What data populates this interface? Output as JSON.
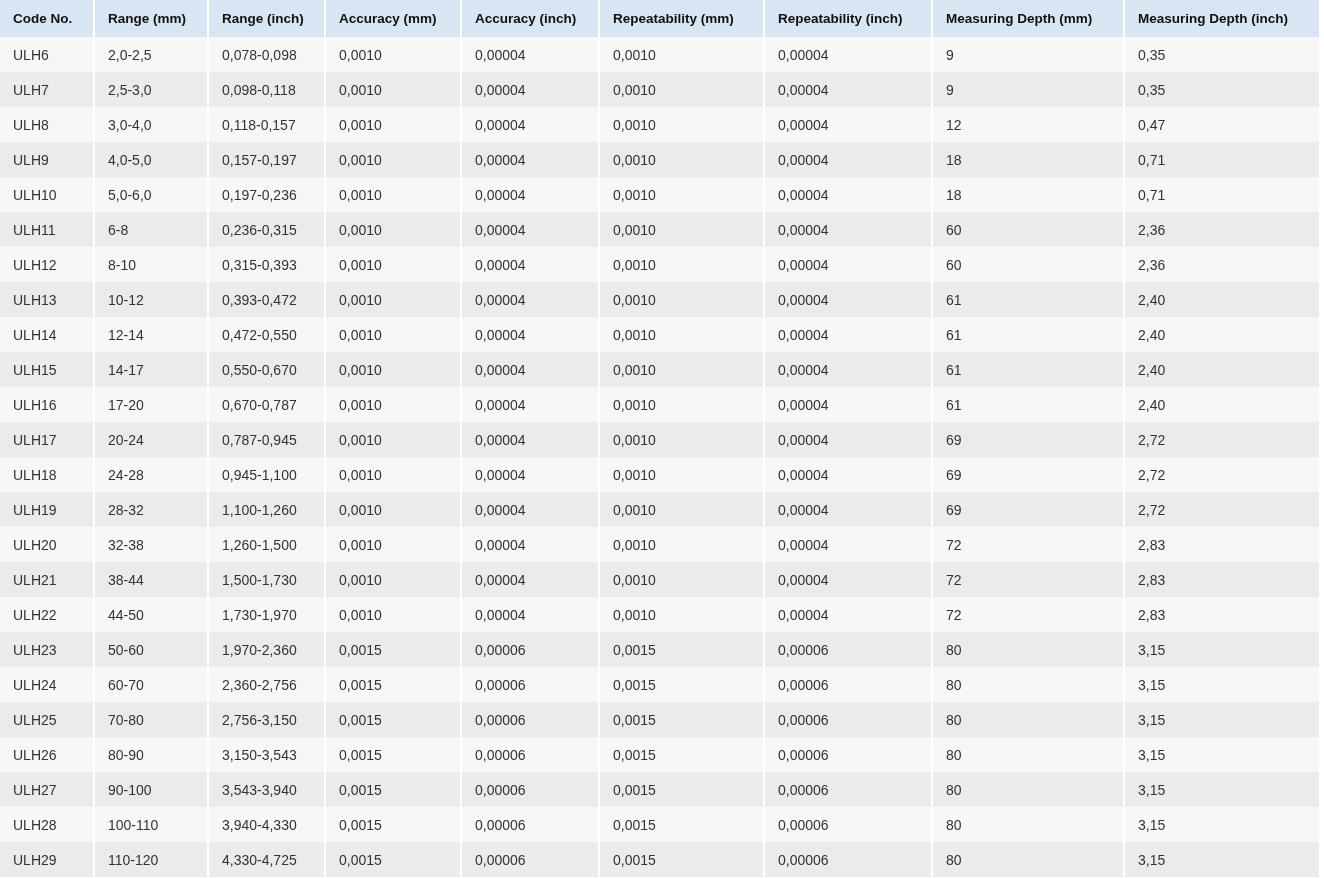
{
  "table": {
    "columns": [
      "Code No.",
      "Range (mm)",
      "Range (inch)",
      "Accuracy (mm)",
      "Accuracy (inch)",
      "Repeatability (mm)",
      "Repeatability (inch)",
      "Measuring Depth (mm)",
      "Measuring Depth (inch)"
    ],
    "rows": [
      [
        "ULH6",
        "2,0-2,5",
        "0,078-0,098",
        "0,0010",
        "0,00004",
        "0,0010",
        "0,00004",
        "9",
        "0,35"
      ],
      [
        "ULH7",
        "2,5-3,0",
        "0,098-0,118",
        "0,0010",
        "0,00004",
        "0,0010",
        "0,00004",
        "9",
        "0,35"
      ],
      [
        "ULH8",
        "3,0-4,0",
        "0,118-0,157",
        "0,0010",
        "0,00004",
        "0,0010",
        "0,00004",
        "12",
        "0,47"
      ],
      [
        "ULH9",
        "4,0-5,0",
        "0,157-0,197",
        "0,0010",
        "0,00004",
        "0,0010",
        "0,00004",
        "18",
        "0,71"
      ],
      [
        "ULH10",
        "5,0-6,0",
        "0,197-0,236",
        "0,0010",
        "0,00004",
        "0,0010",
        "0,00004",
        "18",
        "0,71"
      ],
      [
        "ULH11",
        "6-8",
        "0,236-0,315",
        "0,0010",
        "0,00004",
        "0,0010",
        "0,00004",
        "60",
        "2,36"
      ],
      [
        "ULH12",
        "8-10",
        "0,315-0,393",
        "0,0010",
        "0,00004",
        "0,0010",
        "0,00004",
        "60",
        "2,36"
      ],
      [
        "ULH13",
        "10-12",
        "0,393-0,472",
        "0,0010",
        "0,00004",
        "0,0010",
        "0,00004",
        "61",
        "2,40"
      ],
      [
        "ULH14",
        "12-14",
        "0,472-0,550",
        "0,0010",
        "0,00004",
        "0,0010",
        "0,00004",
        "61",
        "2,40"
      ],
      [
        "ULH15",
        "14-17",
        "0,550-0,670",
        "0,0010",
        "0,00004",
        "0,0010",
        "0,00004",
        "61",
        "2,40"
      ],
      [
        "ULH16",
        "17-20",
        "0,670-0,787",
        "0,0010",
        "0,00004",
        "0,0010",
        "0,00004",
        "61",
        "2,40"
      ],
      [
        "ULH17",
        "20-24",
        "0,787-0,945",
        "0,0010",
        "0,00004",
        "0,0010",
        "0,00004",
        "69",
        "2,72"
      ],
      [
        "ULH18",
        "24-28",
        "0,945-1,100",
        "0,0010",
        "0,00004",
        "0,0010",
        "0,00004",
        "69",
        "2,72"
      ],
      [
        "ULH19",
        "28-32",
        "1,100-1,260",
        "0,0010",
        "0,00004",
        "0,0010",
        "0,00004",
        "69",
        "2,72"
      ],
      [
        "ULH20",
        "32-38",
        "1,260-1,500",
        "0,0010",
        "0,00004",
        "0,0010",
        "0,00004",
        "72",
        "2,83"
      ],
      [
        "ULH21",
        "38-44",
        "1,500-1,730",
        "0,0010",
        "0,00004",
        "0,0010",
        "0,00004",
        "72",
        "2,83"
      ],
      [
        "ULH22",
        "44-50",
        "1,730-1,970",
        "0,0010",
        "0,00004",
        "0,0010",
        "0,00004",
        "72",
        "2,83"
      ],
      [
        "ULH23",
        "50-60",
        "1,970-2,360",
        "0,0015",
        "0,00006",
        "0,0015",
        "0,00006",
        "80",
        "3,15"
      ],
      [
        "ULH24",
        "60-70",
        "2,360-2,756",
        "0,0015",
        "0,00006",
        "0,0015",
        "0,00006",
        "80",
        "3,15"
      ],
      [
        "ULH25",
        "70-80",
        "2,756-3,150",
        "0,0015",
        "0,00006",
        "0,0015",
        "0,00006",
        "80",
        "3,15"
      ],
      [
        "ULH26",
        "80-90",
        "3,150-3,543",
        "0,0015",
        "0,00006",
        "0,0015",
        "0,00006",
        "80",
        "3,15"
      ],
      [
        "ULH27",
        "90-100",
        "3,543-3,940",
        "0,0015",
        "0,00006",
        "0,0015",
        "0,00006",
        "80",
        "3,15"
      ],
      [
        "ULH28",
        "100-110",
        "3,940-4,330",
        "0,0015",
        "0,00006",
        "0,0015",
        "0,00006",
        "80",
        "3,15"
      ],
      [
        "ULH29",
        "110-120",
        "4,330-4,725",
        "0,0015",
        "0,00006",
        "0,0015",
        "0,00006",
        "80",
        "3,15"
      ]
    ]
  }
}
